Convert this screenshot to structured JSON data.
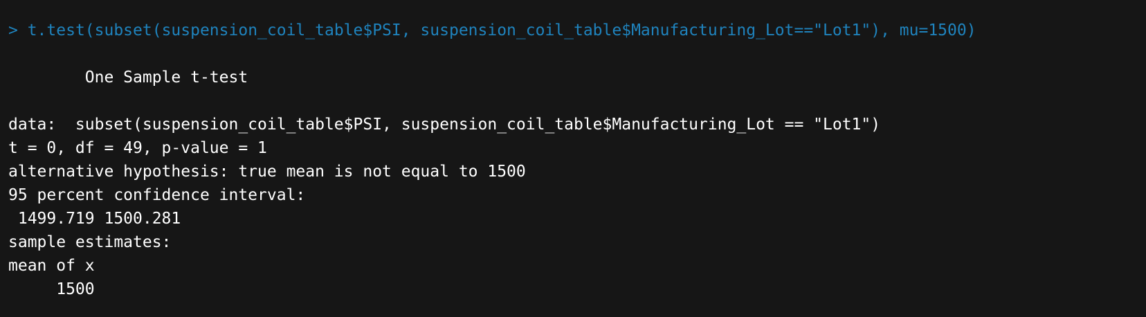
{
  "console": {
    "prompt": "> ",
    "command": "t.test(subset(suspension_coil_table$PSI, suspension_coil_table$Manufacturing_Lot==\"Lot1\"), mu=1500)",
    "output": {
      "title": "        One Sample t-test",
      "data_line": "data:  subset(suspension_coil_table$PSI, suspension_coil_table$Manufacturing_Lot == \"Lot1\")",
      "stats_line": "t = 0, df = 49, p-value = 1",
      "alternative_line": "alternative hypothesis: true mean is not equal to 1500",
      "ci_label": "95 percent confidence interval:",
      "ci_values": " 1499.719 1500.281",
      "estimates_label": "sample estimates:",
      "estimate_name": "mean of x",
      "estimate_value": "     1500"
    },
    "colors": {
      "background": "#161616",
      "command_text": "#1f83bd",
      "output_text": "#ffffff"
    }
  }
}
